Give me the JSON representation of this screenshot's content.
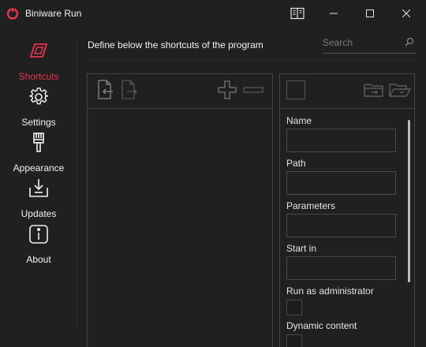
{
  "window": {
    "title": "Biniware Run",
    "brand_color": "#e8334f"
  },
  "sidebar": {
    "items": [
      {
        "label": "Shortcuts",
        "icon": "shortcut-icon",
        "active": true
      },
      {
        "label": "Settings",
        "icon": "gear-icon",
        "active": false
      },
      {
        "label": "Appearance",
        "icon": "brush-icon",
        "active": false
      },
      {
        "label": "Updates",
        "icon": "download-icon",
        "active": false
      },
      {
        "label": "About",
        "icon": "info-icon",
        "active": false
      }
    ]
  },
  "header": {
    "description": "Define below the shortcuts of the program",
    "search_placeholder": "Search"
  },
  "shortcut_list": {
    "toolbar_icons": [
      "import-icon",
      "export-icon",
      "add-icon",
      "remove-icon"
    ],
    "items": []
  },
  "shortcut_editor": {
    "toolbar_icons": [
      "color-swatch",
      "browse-file-icon",
      "browse-folder-icon"
    ],
    "fields": {
      "name_label": "Name",
      "name_value": "",
      "path_label": "Path",
      "path_value": "",
      "parameters_label": "Parameters",
      "parameters_value": "",
      "start_in_label": "Start in",
      "start_in_value": "",
      "run_as_admin_label": "Run as administrator",
      "run_as_admin_checked": false,
      "dynamic_content_label": "Dynamic content",
      "dynamic_content_checked": false
    }
  }
}
